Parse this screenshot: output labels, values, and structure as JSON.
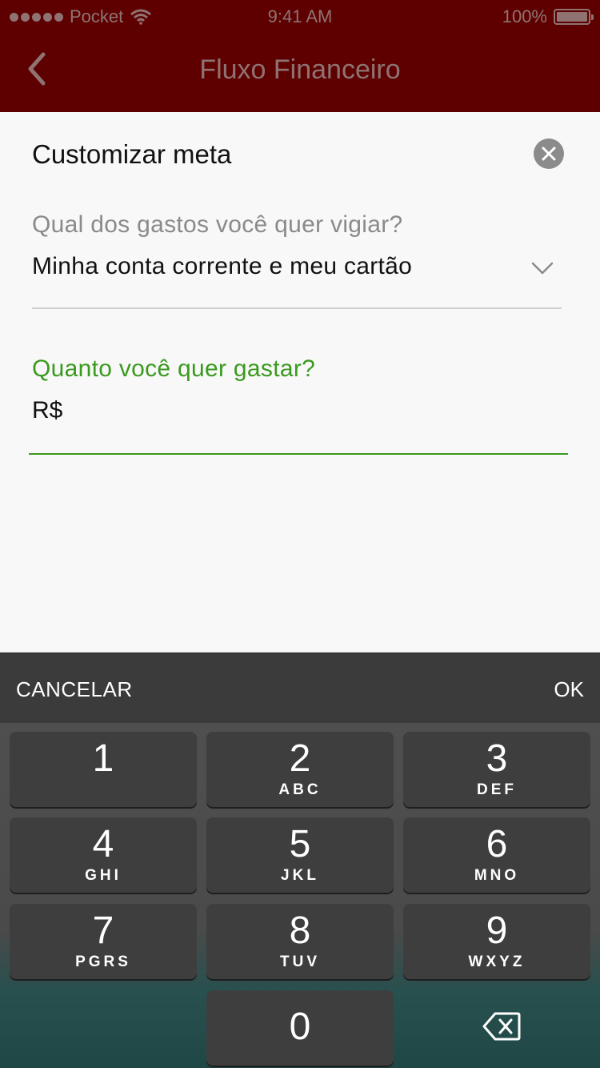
{
  "status_bar": {
    "carrier": "Pocket",
    "time": "9:41 AM",
    "battery": "100%"
  },
  "nav": {
    "title": "Fluxo Financeiro"
  },
  "form": {
    "title": "Customizar meta",
    "question1_label": "Qual dos gastos você quer vigiar?",
    "question1_value": "Minha conta corrente e meu cartão",
    "question2_label": "Quanto você quer gastar?",
    "question2_value": "R$"
  },
  "keyboard_toolbar": {
    "cancel_label": "CANCELAR",
    "ok_label": "OK"
  },
  "keypad": {
    "k1": {
      "num": "1",
      "letters": ""
    },
    "k2": {
      "num": "2",
      "letters": "ABC"
    },
    "k3": {
      "num": "3",
      "letters": "DEF"
    },
    "k4": {
      "num": "4",
      "letters": "GHI"
    },
    "k5": {
      "num": "5",
      "letters": "JKL"
    },
    "k6": {
      "num": "6",
      "letters": "MNO"
    },
    "k7": {
      "num": "7",
      "letters": "PGRS"
    },
    "k8": {
      "num": "8",
      "letters": "TUV"
    },
    "k9": {
      "num": "9",
      "letters": "WXYZ"
    },
    "k0": {
      "num": "0"
    }
  },
  "icons": {
    "back": "chevron-left-icon",
    "close": "close-icon",
    "dropdown": "chevron-down-icon",
    "delete": "backspace-icon",
    "wifi": "wifi-icon",
    "battery": "battery-icon"
  },
  "colors": {
    "header_bg": "#5e0000",
    "header_text": "#8f7373",
    "accent_green": "#3a9a1e",
    "keyboard_bg": "#4a4a4a",
    "key_bg": "#3e3e3e"
  }
}
